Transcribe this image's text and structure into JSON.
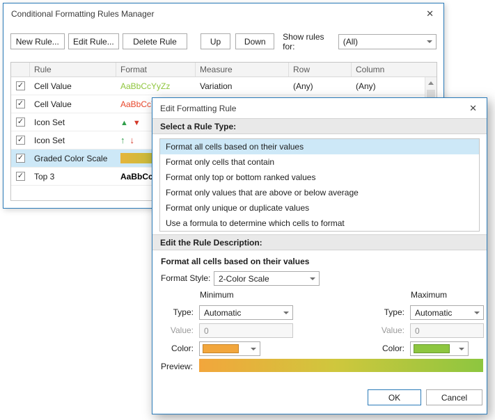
{
  "manager": {
    "title": "Conditional Formatting Rules Manager",
    "close_icon": "✕",
    "toolbar": {
      "new_rule": "New Rule...",
      "edit_rule": "Edit Rule...",
      "delete_rule": "Delete Rule",
      "up": "Up",
      "down": "Down",
      "show_rules_for_label": "Show rules for:",
      "show_rules_for_value": "(All)"
    },
    "table": {
      "headers": {
        "rule": "Rule",
        "format": "Format",
        "measure": "Measure",
        "row": "Row",
        "column": "Column"
      },
      "rows": [
        {
          "checked": true,
          "selected": false,
          "rule": "Cell Value",
          "format": "AaBbCcYyZz",
          "format_style": "green-text",
          "measure": "Variation",
          "row": "(Any)",
          "column": "(Any)"
        },
        {
          "checked": true,
          "selected": false,
          "rule": "Cell Value",
          "format": "AaBbCcYyZz",
          "format_style": "red-text",
          "measure": "",
          "row": "",
          "column": ""
        },
        {
          "checked": true,
          "selected": false,
          "rule": "Icon Set",
          "format": "",
          "format_style": "triangle-icons",
          "measure": "",
          "row": "",
          "column": ""
        },
        {
          "checked": true,
          "selected": false,
          "rule": "Icon Set",
          "format": "",
          "format_style": "arrow-icons",
          "measure": "",
          "row": "",
          "column": ""
        },
        {
          "checked": true,
          "selected": true,
          "rule": "Graded Color Scale",
          "format": "",
          "format_style": "gradient-swatch",
          "measure": "",
          "row": "",
          "column": ""
        },
        {
          "checked": true,
          "selected": false,
          "rule": "Top 3",
          "format": "AaBbCcYyZz",
          "format_style": "bold-text",
          "measure": "",
          "row": "",
          "column": ""
        }
      ]
    }
  },
  "edit": {
    "title": "Edit Formatting Rule",
    "close_icon": "✕",
    "rule_type_section": "Select a Rule Type:",
    "rule_types": [
      {
        "label": "Format all cells based on their values",
        "selected": true
      },
      {
        "label": "Format only cells that contain",
        "selected": false
      },
      {
        "label": "Format only top or bottom ranked values",
        "selected": false
      },
      {
        "label": "Format only values that are above or below average",
        "selected": false
      },
      {
        "label": "Format only unique or duplicate values",
        "selected": false
      },
      {
        "label": "Use a formula to determine which cells to format",
        "selected": false
      }
    ],
    "description_section": "Edit the Rule Description:",
    "description_title": "Format all cells based on their values",
    "format_style_label": "Format Style:",
    "format_style_value": "2-Color Scale",
    "minimum": {
      "header": "Minimum",
      "type_label": "Type:",
      "type_value": "Automatic",
      "value_label": "Value:",
      "value": "0",
      "color_label": "Color:",
      "color": "#F2A63C"
    },
    "maximum": {
      "header": "Maximum",
      "type_label": "Type:",
      "type_value": "Automatic",
      "value_label": "Value:",
      "value": "0",
      "color_label": "Color:",
      "color": "#8DC63F"
    },
    "preview_label": "Preview:",
    "preview_gradient": [
      "#F2A63C",
      "#8DC63F"
    ],
    "ok_label": "OK",
    "cancel_label": "Cancel"
  },
  "icons": {
    "check": "✓",
    "triangle_up": "▲",
    "triangle_down": "▼",
    "arrow_up": "↑",
    "arrow_down": "↓"
  },
  "colors": {
    "dialog_border": "#2A7AB8",
    "selection": "#CDE8F7",
    "section_header_bg": "#E9E9E9",
    "green_text": "#8FC63D",
    "red_text": "#E8472B",
    "icon_green": "#2F9E49",
    "icon_red": "#D33828",
    "scale_gradient_start": "#E5B53C",
    "scale_gradient_end": "#A2C33C"
  }
}
